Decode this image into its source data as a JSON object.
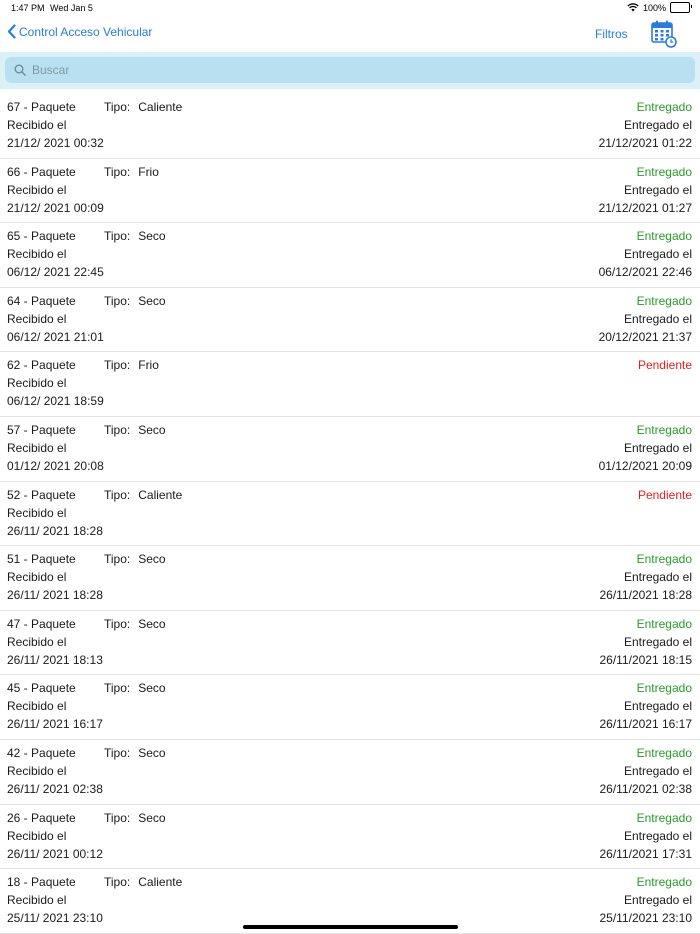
{
  "status_bar": {
    "time": "1:47 PM",
    "date": "Wed Jan 5",
    "battery": "100%"
  },
  "nav": {
    "back_label": "Control Acceso Vehicular",
    "filter_label": "Filtros"
  },
  "search": {
    "placeholder": "Buscar"
  },
  "labels": {
    "tipo": "Tipo:",
    "recibido": "Recibido el",
    "entregado": "Entregado el"
  },
  "rows": [
    {
      "id": "67 - Paquete",
      "tipo": "Caliente",
      "received": "21/12/ 2021 00:32",
      "status": "Entregado",
      "delivered": "21/12/2021 01:22"
    },
    {
      "id": "66 - Paquete",
      "tipo": "Frio",
      "received": "21/12/ 2021 00:09",
      "status": "Entregado",
      "delivered": "21/12/2021 01:27"
    },
    {
      "id": "65 - Paquete",
      "tipo": "Seco",
      "received": "06/12/ 2021 22:45",
      "status": "Entregado",
      "delivered": "06/12/2021 22:46"
    },
    {
      "id": "64 - Paquete",
      "tipo": "Seco",
      "received": "06/12/ 2021 21:01",
      "status": "Entregado",
      "delivered": "20/12/2021 21:37"
    },
    {
      "id": "62 - Paquete",
      "tipo": "Frio",
      "received": "06/12/ 2021 18:59",
      "status": "Pendiente",
      "delivered": ""
    },
    {
      "id": "57 - Paquete",
      "tipo": "Seco",
      "received": "01/12/ 2021 20:08",
      "status": "Entregado",
      "delivered": "01/12/2021 20:09"
    },
    {
      "id": "52 - Paquete",
      "tipo": "Caliente",
      "received": "26/11/ 2021 18:28",
      "status": "Pendiente",
      "delivered": ""
    },
    {
      "id": "51 - Paquete",
      "tipo": "Seco",
      "received": "26/11/ 2021 18:28",
      "status": "Entregado",
      "delivered": "26/11/2021 18:28"
    },
    {
      "id": "47 - Paquete",
      "tipo": "Seco",
      "received": "26/11/ 2021 18:13",
      "status": "Entregado",
      "delivered": "26/11/2021 18:15"
    },
    {
      "id": "45 - Paquete",
      "tipo": "Seco",
      "received": "26/11/ 2021 16:17",
      "status": "Entregado",
      "delivered": "26/11/2021 16:17"
    },
    {
      "id": "42 - Paquete",
      "tipo": "Seco",
      "received": "26/11/ 2021 02:38",
      "status": "Entregado",
      "delivered": "26/11/2021 02:38"
    },
    {
      "id": "26 - Paquete",
      "tipo": "Seco",
      "received": "26/11/ 2021 00:12",
      "status": "Entregado",
      "delivered": "26/11/2021 17:31"
    },
    {
      "id": "18 - Paquete",
      "tipo": "Caliente",
      "received": "25/11/ 2021 23:10",
      "status": "Entregado",
      "delivered": "25/11/2021 23:10"
    }
  ],
  "colors": {
    "accent": "#2c7bd6",
    "delivered": "#2a9a2a",
    "pending": "#e02020",
    "search_bg": "#dcf0f8"
  },
  "icons": {
    "back": "chevron-left-icon",
    "calendar": "calendar-icon",
    "search": "search-icon",
    "wifi": "wifi-icon",
    "battery": "battery-icon"
  }
}
